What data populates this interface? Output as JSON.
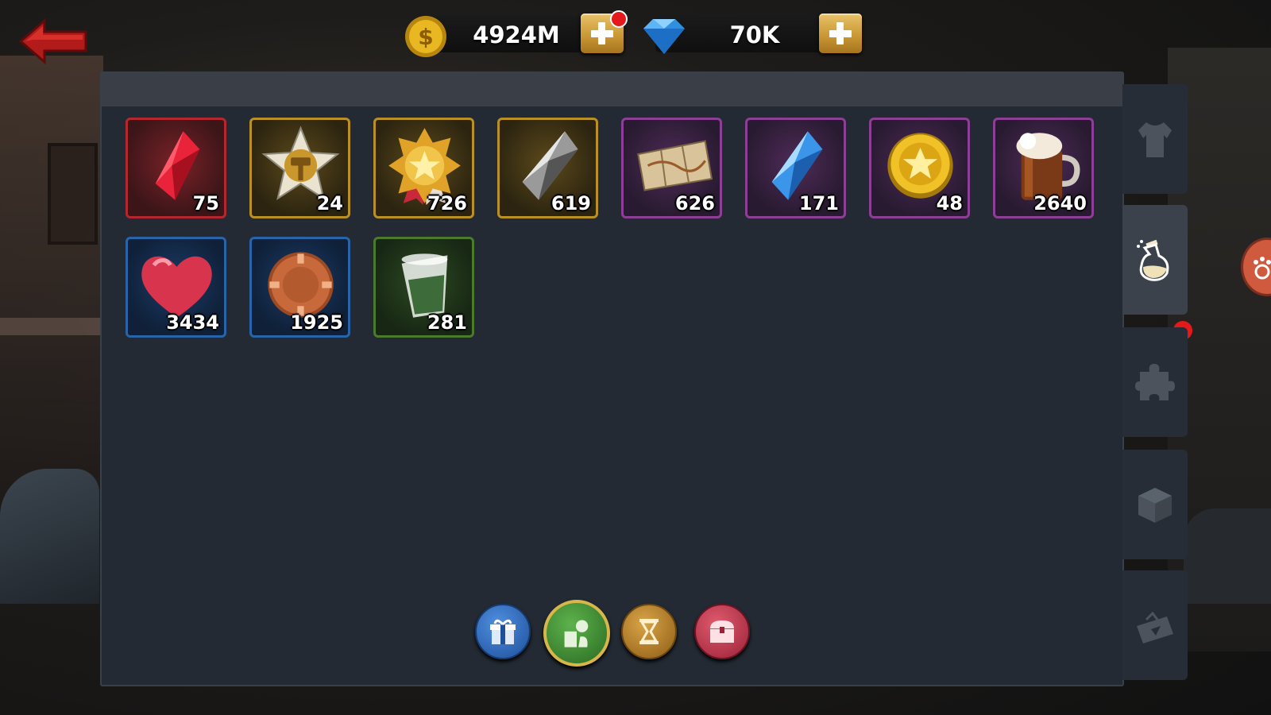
{
  "currencies": {
    "gold": {
      "value": "4924M",
      "icon": "gold-coin-icon"
    },
    "gems": {
      "value": "70K",
      "icon": "diamond-icon"
    }
  },
  "items": [
    {
      "icon": "red-crystal-icon",
      "count": "75",
      "rarity": "red"
    },
    {
      "icon": "hammer-star-medal-icon",
      "count": "24",
      "rarity": "gold"
    },
    {
      "icon": "star-medal-icon",
      "count": "726",
      "rarity": "gold"
    },
    {
      "icon": "silver-crystal-icon",
      "count": "619",
      "rarity": "gold"
    },
    {
      "icon": "treasure-map-icon",
      "count": "626",
      "rarity": "purple"
    },
    {
      "icon": "blue-crystal-icon",
      "count": "171",
      "rarity": "purple"
    },
    {
      "icon": "star-coin-icon",
      "count": "48",
      "rarity": "purple"
    },
    {
      "icon": "beer-mug-icon",
      "count": "2640",
      "rarity": "purple"
    },
    {
      "icon": "heart-icon",
      "count": "3434",
      "rarity": "blue"
    },
    {
      "icon": "copper-chip-icon",
      "count": "1925",
      "rarity": "blue"
    },
    {
      "icon": "shot-glass-icon",
      "count": "281",
      "rarity": "green"
    }
  ],
  "filters": [
    "gift-box-icon",
    "consumables-icon",
    "hourglass-icon",
    "treasure-chest-icon"
  ],
  "side_tabs": [
    "shirt-icon",
    "potion-icon",
    "puzzle-piece-icon",
    "box-icon",
    "ticket-icon"
  ],
  "colors": {
    "panel": "#232a33",
    "accent_gold": "#c79531",
    "notification": "#e3191b"
  }
}
